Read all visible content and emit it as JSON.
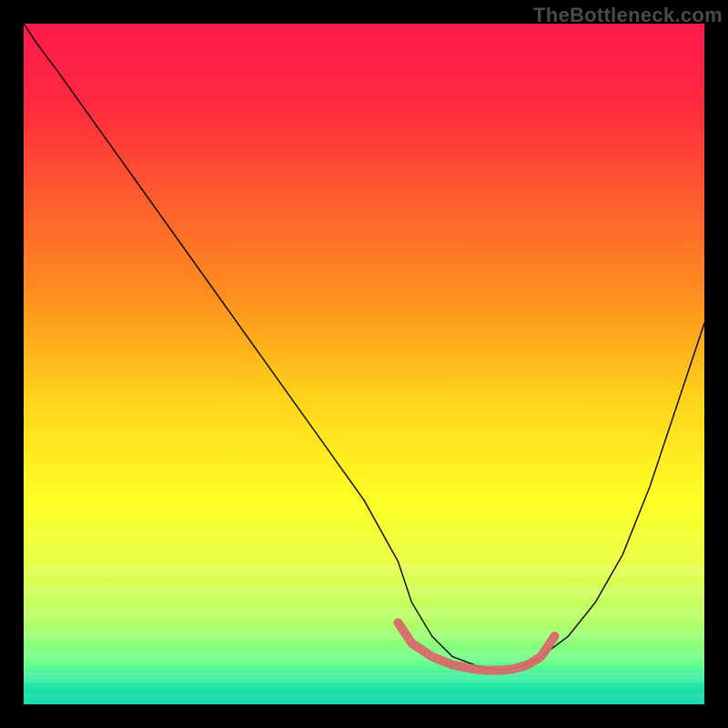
{
  "watermark": "TheBottleneck.com",
  "chart_data": {
    "type": "line",
    "title": "",
    "xlabel": "",
    "ylabel": "",
    "xlim": [
      0,
      100
    ],
    "ylim": [
      0,
      100
    ],
    "grid": false,
    "legend": false,
    "gradient_stops": [
      {
        "offset": 0.0,
        "color": "#ff1a4d"
      },
      {
        "offset": 0.12,
        "color": "#ff2a3f"
      },
      {
        "offset": 0.25,
        "color": "#ff5a2f"
      },
      {
        "offset": 0.4,
        "color": "#ff8f1f"
      },
      {
        "offset": 0.55,
        "color": "#ffd31a"
      },
      {
        "offset": 0.7,
        "color": "#ffff26"
      },
      {
        "offset": 0.8,
        "color": "#e6ff4d"
      },
      {
        "offset": 0.88,
        "color": "#b3ff66"
      },
      {
        "offset": 0.94,
        "color": "#66ff8c"
      },
      {
        "offset": 0.97,
        "color": "#26e6a6"
      },
      {
        "offset": 1.0,
        "color": "#00d4a0"
      }
    ],
    "striping_band": {
      "y_start": 78,
      "y_end": 100,
      "stripe_count": 14
    },
    "series": [
      {
        "name": "curve",
        "x": [
          0,
          2,
          5,
          10,
          15,
          20,
          25,
          30,
          35,
          40,
          45,
          50,
          55,
          57,
          60,
          63,
          67,
          70,
          73,
          76,
          80,
          84,
          88,
          92,
          96,
          100
        ],
        "y": [
          100,
          97,
          93,
          86,
          79,
          72,
          65,
          58,
          51,
          44,
          37,
          30,
          21,
          15,
          10,
          7,
          5.5,
          5,
          5.5,
          7,
          10,
          15,
          22,
          32,
          44,
          56
        ],
        "stroke": "#000000",
        "width": 1.4
      },
      {
        "name": "highlight",
        "x": [
          55,
          57,
          60,
          63,
          66,
          68,
          70,
          72,
          74,
          76,
          78
        ],
        "y": [
          12,
          9,
          7,
          5.8,
          5.2,
          5.0,
          5.0,
          5.2,
          5.8,
          7,
          10
        ],
        "stroke": "#d86a6a",
        "width": 10
      }
    ]
  }
}
